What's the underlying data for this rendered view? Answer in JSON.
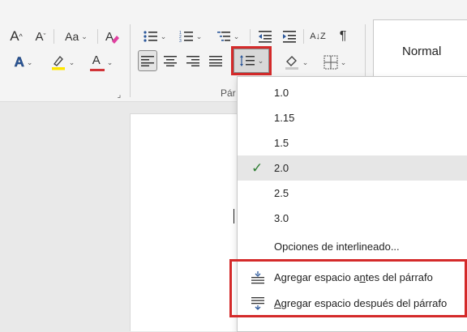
{
  "ribbon": {
    "font_grow": "A",
    "font_shrink": "A",
    "change_case": "Aa",
    "text_effects": "A",
    "font_color": "A",
    "font_color_value": "#d13438",
    "highlight_color_value": "#ffe600",
    "sort_label": "A↓Z",
    "pilcrow": "¶",
    "paragraph_group_label": "Pár",
    "style_normal": "Normal"
  },
  "menu": {
    "spacing_items": [
      {
        "label": "1.0",
        "checked": false
      },
      {
        "label": "1.15",
        "checked": false
      },
      {
        "label": "1.5",
        "checked": false
      },
      {
        "label": "2.0",
        "checked": true
      },
      {
        "label": "2.5",
        "checked": false
      },
      {
        "label": "3.0",
        "checked": false
      }
    ],
    "options_label": "Opciones de interlineado...",
    "add_before": {
      "pre": "Agregar espacio a",
      "ul": "n",
      "post": "tes del párrafo"
    },
    "add_after": {
      "pre": "",
      "ul": "A",
      "post": "gregar espacio después del párrafo"
    },
    "check_mark": "✓"
  },
  "colors": {
    "accent": "#2b579a",
    "highlight_border": "#d42a2a",
    "check": "#2e7d32"
  }
}
